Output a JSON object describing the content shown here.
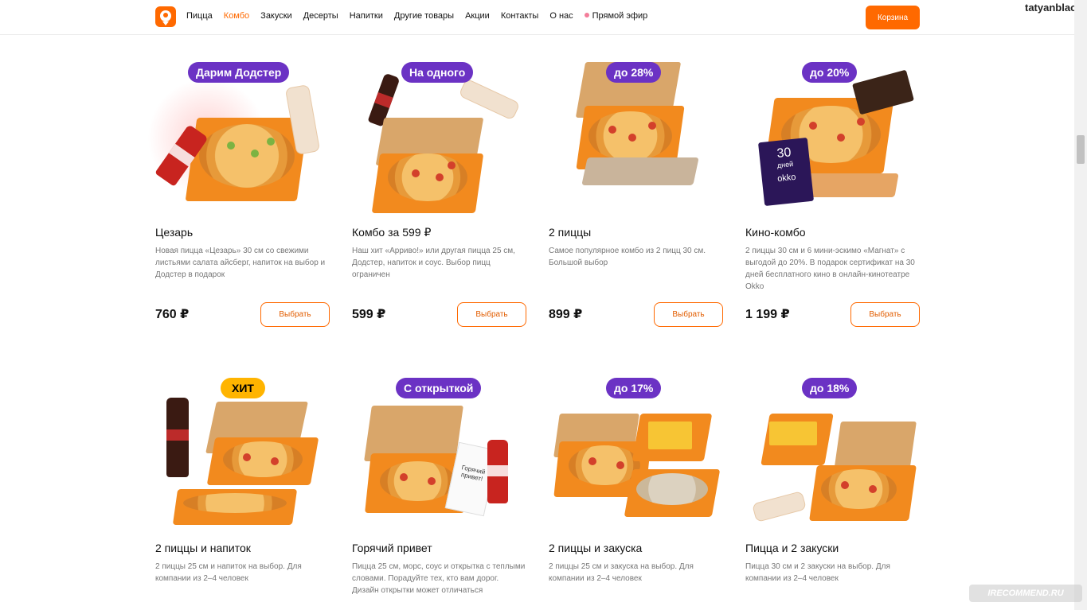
{
  "header": {
    "nav": [
      "Пицца",
      "Комбо",
      "Закуски",
      "Десерты",
      "Напитки",
      "Другие товары",
      "Акции",
      "Контакты",
      "О нас",
      "Прямой эфир"
    ],
    "active_index": 1,
    "cart_label": "Корзина",
    "username": "tatyanblack"
  },
  "products": [
    {
      "badge": "Дарим Додстер",
      "badge_color": "purple",
      "title": "Цезарь",
      "description": "Новая пицца «Цезарь» 30 см со свежими листьями салата айсберг, напиток на выбор и Додстер в подарок",
      "price": "760 ₽",
      "button": "Выбрать"
    },
    {
      "badge": "На одного",
      "badge_color": "purple",
      "title": "Комбо за 599 ₽",
      "description": "Наш хит «Арриво!» или другая пицца 25 см, Додстер, напиток и соус. Выбор пицц ограничен",
      "price": "599 ₽",
      "button": "Выбрать"
    },
    {
      "badge": "до 28%",
      "badge_color": "purple",
      "title": "2 пиццы",
      "description": "Самое популярное комбо из 2 пицц 30 см. Большой выбор",
      "price": "899 ₽",
      "button": "Выбрать"
    },
    {
      "badge": "до 20%",
      "badge_color": "purple",
      "title": "Кино-комбо",
      "description": "2 пиццы 30 см и 6 мини-эскимо «Магнат» с выгодой до 20%. В подарок сертификат на 30 дней бесплатного кино в онлайн-кинотеатре Okko",
      "price": "1 199 ₽",
      "button": "Выбрать",
      "okko_number": "30",
      "okko_days": "дней",
      "okko_brand": "okko"
    },
    {
      "badge": "ХИТ",
      "badge_color": "yellow",
      "title": "2 пиццы и напиток",
      "description": "2 пиццы 25 см и напиток на выбор. Для компании из 2–4 человек"
    },
    {
      "badge": "С открыткой",
      "badge_color": "purple",
      "title": "Горячий привет",
      "description": "Пицца 25 см, морс, соус и открытка с теплыми словами. Порадуйте тех, кто вам дорог. Дизайн открытки может отличаться",
      "card_text": "Горячий привет!"
    },
    {
      "badge": "до 17%",
      "badge_color": "purple",
      "title": "2 пиццы и закуска",
      "description": "2 пиццы 25 см и закуска на выбор. Для компании из 2–4 человек"
    },
    {
      "badge": "до 18%",
      "badge_color": "purple",
      "title": "Пицца и 2 закуски",
      "description": "Пицца 30 см и 2 закуски на выбор. Для компании из 2–4 человек"
    }
  ],
  "watermark": "IRECOMMEND.RU",
  "colors": {
    "accent": "#ff6900",
    "badge_purple": "#6b32c4",
    "badge_yellow": "#ffb400"
  }
}
